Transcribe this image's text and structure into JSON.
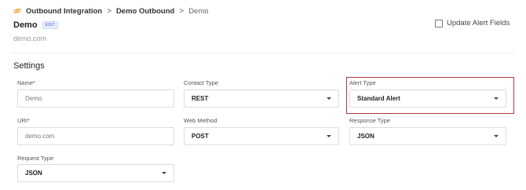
{
  "breadcrumb": {
    "items": [
      "Outbound Integration",
      "Demo Outbound",
      "Demo"
    ],
    "separator": ">"
  },
  "header": {
    "title": "Demo",
    "edit_badge": "EDIT",
    "subtitle": "demo.com",
    "update_alert_label": "Update Alert Fields",
    "update_alert_checked": false
  },
  "settings": {
    "section_title": "Settings",
    "fields": {
      "name": {
        "label": "Name*",
        "value": "Demo"
      },
      "contact_type": {
        "label": "Contact Type",
        "value": "REST"
      },
      "alert_type": {
        "label": "Alert Type",
        "value": "Standard Alert"
      },
      "uri": {
        "label": "URI*",
        "value": "demo.com"
      },
      "web_method": {
        "label": "Web Method",
        "value": "POST"
      },
      "response_type": {
        "label": "Response Type",
        "value": "JSON"
      },
      "request_type": {
        "label": "Request Type",
        "value": "JSON"
      }
    }
  },
  "colors": {
    "highlight_border": "#b0393a",
    "breadcrumb_icon": "#f0a020",
    "edit_badge_text": "#3a5ad6"
  },
  "icons": {
    "breadcrumb": "link-icon",
    "dropdown": "chevron-down-icon"
  }
}
